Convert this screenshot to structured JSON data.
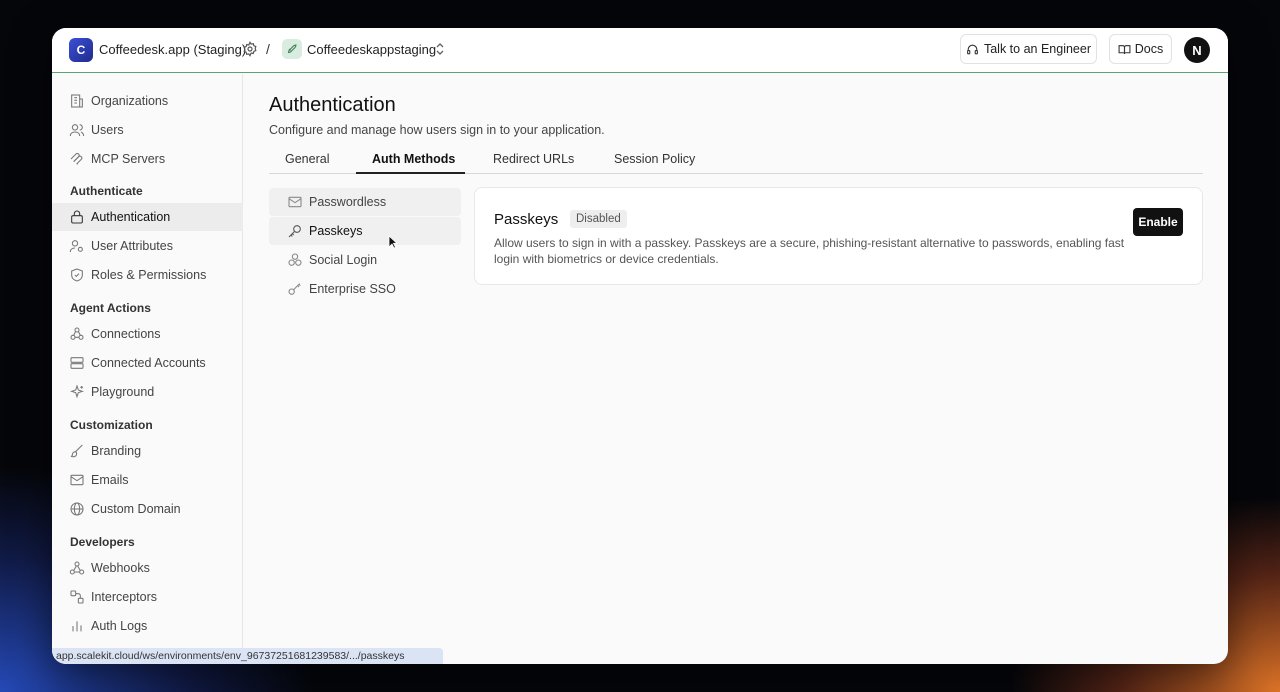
{
  "topbar": {
    "org_initial": "C",
    "org_name": "Coffeedesk.app (Staging)",
    "separator": "/",
    "env_name": "Coffeedeskappstaging",
    "talk_label": "Talk to an Engineer",
    "docs_label": "Docs",
    "user_initial": "N"
  },
  "sidebar": {
    "items_top": [
      {
        "label": "Organizations",
        "icon": "building-icon"
      },
      {
        "label": "Users",
        "icon": "users-icon"
      },
      {
        "label": "MCP Servers",
        "icon": "mcp-icon"
      }
    ],
    "sections": [
      {
        "title": "Authenticate",
        "items": [
          {
            "label": "Authentication",
            "icon": "lock-icon",
            "active": true
          },
          {
            "label": "User Attributes",
            "icon": "user-attributes-icon"
          },
          {
            "label": "Roles & Permissions",
            "icon": "shield-icon"
          }
        ]
      },
      {
        "title": "Agent Actions",
        "items": [
          {
            "label": "Connections",
            "icon": "connections-icon"
          },
          {
            "label": "Connected Accounts",
            "icon": "server-icon"
          },
          {
            "label": "Playground",
            "icon": "sparkle-icon"
          }
        ]
      },
      {
        "title": "Customization",
        "items": [
          {
            "label": "Branding",
            "icon": "brush-icon"
          },
          {
            "label": "Emails",
            "icon": "mail-icon"
          },
          {
            "label": "Custom Domain",
            "icon": "globe-icon"
          }
        ]
      },
      {
        "title": "Developers",
        "items": [
          {
            "label": "Webhooks",
            "icon": "webhook-icon"
          },
          {
            "label": "Interceptors",
            "icon": "interceptor-icon"
          },
          {
            "label": "Auth Logs",
            "icon": "bar-chart-icon"
          }
        ]
      }
    ]
  },
  "main": {
    "title": "Authentication",
    "subtitle": "Configure and manage how users sign in to your application.",
    "tabs": [
      "General",
      "Auth Methods",
      "Redirect URLs",
      "Session Policy"
    ],
    "active_tab": "Auth Methods",
    "methods": [
      {
        "label": "Passwordless",
        "icon": "mail-icon"
      },
      {
        "label": "Passkeys",
        "icon": "key-icon"
      },
      {
        "label": "Social Login",
        "icon": "social-icon"
      },
      {
        "label": "Enterprise SSO",
        "icon": "sso-key-icon"
      }
    ],
    "card": {
      "title": "Passkeys",
      "status": "Disabled",
      "description": "Allow users to sign in with a passkey. Passkeys are a secure, phishing-resistant alternative to passwords, enabling fast login with biometrics or device credentials.",
      "button": "Enable"
    }
  },
  "status_bar": {
    "url": "app.scalekit.cloud/ws/environments/env_96737251681239583/.../passkeys"
  },
  "colors": {
    "accent_border": "#5aa66e",
    "org_avatar": "#2f3fb8",
    "enable_button": "#111111"
  }
}
